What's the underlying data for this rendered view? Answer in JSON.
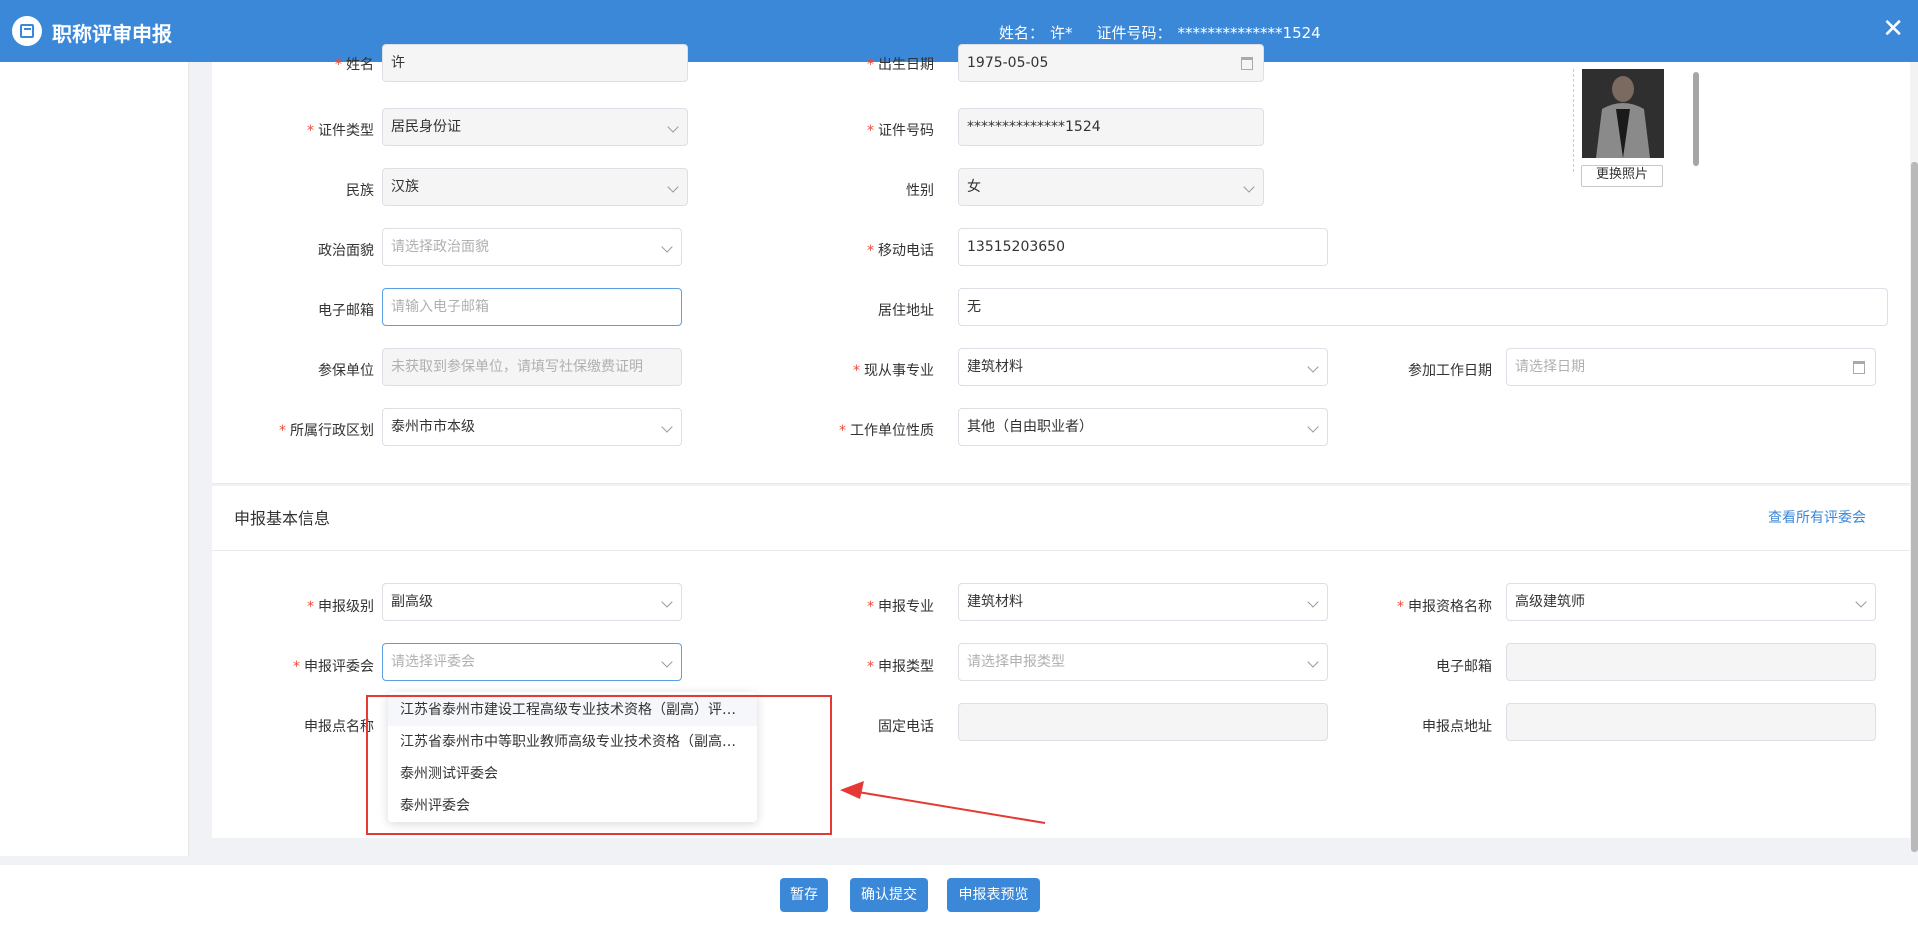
{
  "header": {
    "app_title": "职称评审申报",
    "name_label": "姓名：",
    "name_value": "许*",
    "id_label": "证件号码：",
    "id_value": "**************1524",
    "close_icon": "close-icon"
  },
  "personal": {
    "name_label": "姓名",
    "name_value": "许",
    "birth_label": "出生日期",
    "birth_value": "1975-05-05",
    "idtype_label": "证件类型",
    "idtype_value": "居民身份证",
    "idno_label": "证件号码",
    "idno_value": "**************1524",
    "ethnic_label": "民族",
    "ethnic_value": "汉族",
    "gender_label": "性别",
    "gender_value": "女",
    "political_label": "政治面貌",
    "political_placeholder": "请选择政治面貌",
    "mobile_label": "移动电话",
    "mobile_value": "13515203650",
    "email_label": "电子邮箱",
    "email_placeholder": "请输入电子邮箱",
    "address_label": "居住地址",
    "address_value": "无",
    "insure_label": "参保单位",
    "insure_placeholder": "未获取到参保单位，请填写社保缴费证明",
    "major_label": "现从事专业",
    "major_value": "建筑材料",
    "workdate_label": "参加工作日期",
    "workdate_placeholder": "请选择日期",
    "region_label": "所属行政区划",
    "region_value": "泰州市市本级",
    "unit_label": "工作单位性质",
    "unit_value": "其他（自由职业者）",
    "photo_button": "更换照片"
  },
  "apply": {
    "section_title": "申报基本信息",
    "view_all_link": "查看所有评委会",
    "level_label": "申报级别",
    "level_value": "副高级",
    "major_label": "申报专业",
    "major_value": "建筑材料",
    "qual_label": "申报资格名称",
    "qual_value": "高级建筑师",
    "committee_label": "申报评委会",
    "committee_placeholder": "请选择评委会",
    "type_label": "申报类型",
    "type_placeholder": "请选择申报类型",
    "email_label": "电子邮箱",
    "point_label": "申报点名称",
    "phone_label": "固定电话",
    "point_addr_label": "申报点地址"
  },
  "dropdown": {
    "options": [
      "江苏省泰州市建设工程高级专业技术资格（副高）评…",
      "江苏省泰州市中等职业教师高级专业技术资格（副高…",
      "泰州测试评委会",
      "泰州评委会"
    ]
  },
  "footer": {
    "save_label": "暂存",
    "submit_label": "确认提交",
    "preview_label": "申报表预览"
  },
  "colors": {
    "primary": "#3b88d9",
    "required": "#e74c3c",
    "annotation": "#e53935"
  }
}
